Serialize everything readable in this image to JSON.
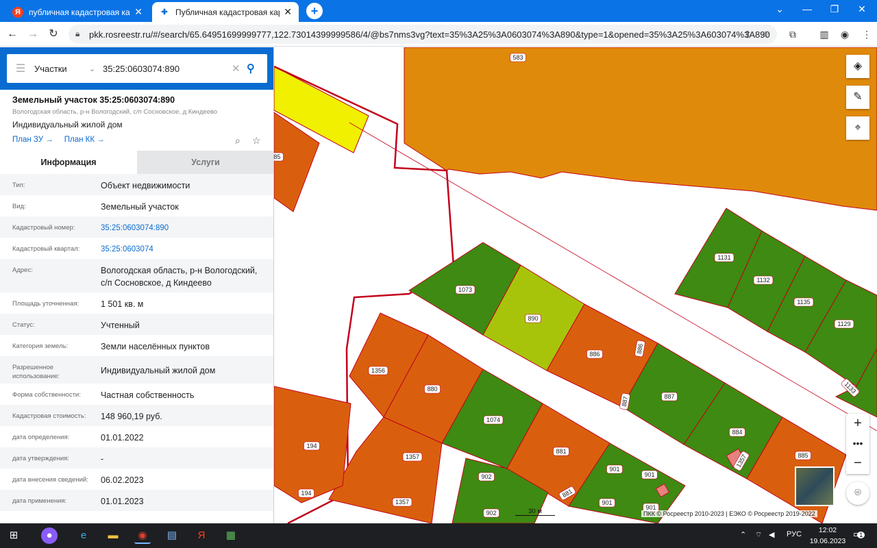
{
  "browser": {
    "tabs": [
      {
        "title": "публичная кадастровая карта",
        "favicon": "yandex-icon",
        "active": false
      },
      {
        "title": "Публичная кадастровая карта",
        "favicon": "pkk-icon",
        "active": true
      }
    ],
    "url": "pkk.rosreestr.ru/#/search/65.64951699999777,122.73014399999586/4/@bs7nms3vg?text=35%3A25%3A0603074%3A890&type=1&opened=35%3A25%3A603074%3A890"
  },
  "search": {
    "menu_icon": "hamburger-icon",
    "type_label": "Участки",
    "query": "35:25:0603074:890"
  },
  "object": {
    "title": "Земельный участок 35:25:0603074:890",
    "address_short": "Вологодская область, р-н Вологодский, с/п Сосновское, д Киндеево",
    "usage": "Индивидуальный жилой дом",
    "link_plan_zu": "План ЗУ →",
    "link_plan_kk": "План КК →"
  },
  "tabs": {
    "info": "Информация",
    "services": "Услуги"
  },
  "info_rows": [
    {
      "label": "Тип:",
      "value": "Объект недвижимости"
    },
    {
      "label": "Вид:",
      "value": "Земельный участок"
    },
    {
      "label": "Кадастровый номер:",
      "value": "35:25:0603074:890"
    },
    {
      "label": "Кадастровый квартал:",
      "value": "35:25:0603074"
    },
    {
      "label": "Адрес:",
      "value": "Вологодская область, р-н Вологодский, с/п Сосновское, д Киндеево"
    },
    {
      "label": "Площадь уточненная:",
      "value": "1 501 кв. м"
    },
    {
      "label": "Статус:",
      "value": "Учтенный"
    },
    {
      "label": "Категория земель:",
      "value": "Земли населённых пунктов"
    },
    {
      "label": "Разрешенное использование:",
      "value": "Индивидуальный жилой дом"
    },
    {
      "label": "Форма собственности:",
      "value": "Частная собственность"
    },
    {
      "label": "Кадастровая стоимость:",
      "value": "148 960,19 руб."
    },
    {
      "label": "дата определения:",
      "value": "01.01.2022"
    },
    {
      "label": "дата утверждения:",
      "value": "-"
    },
    {
      "label": "дата внесения сведений:",
      "value": "06.02.2023"
    },
    {
      "label": "дата применения:",
      "value": "01.01.2023"
    }
  ],
  "map": {
    "parcel_labels": [
      "583",
      "1073",
      "890",
      "886",
      "886",
      "887",
      "887",
      "884",
      "1131",
      "1132",
      "1135",
      "1129",
      "1133",
      "1356",
      "880",
      "1074",
      "194",
      "194",
      "1357",
      "1357",
      "881",
      "881",
      "902",
      "902",
      "901",
      "901",
      "901",
      "901",
      "1357",
      "885",
      "885",
      "5"
    ],
    "scale_label": "30 м",
    "attribution": "ПКК © Росреестр 2010-2023 | ЕЭКО © Росреестр 2019-2022",
    "colors": {
      "orange": "#d95f0e",
      "amber": "#e08a0b",
      "green": "#3e8a12",
      "yellow": "#f0f000",
      "selected": "#a8c40a",
      "border": "#c2001b"
    }
  },
  "taskbar": {
    "language": "РУС",
    "time": "12:02",
    "date": "19.06.2023",
    "notifications": "1"
  }
}
